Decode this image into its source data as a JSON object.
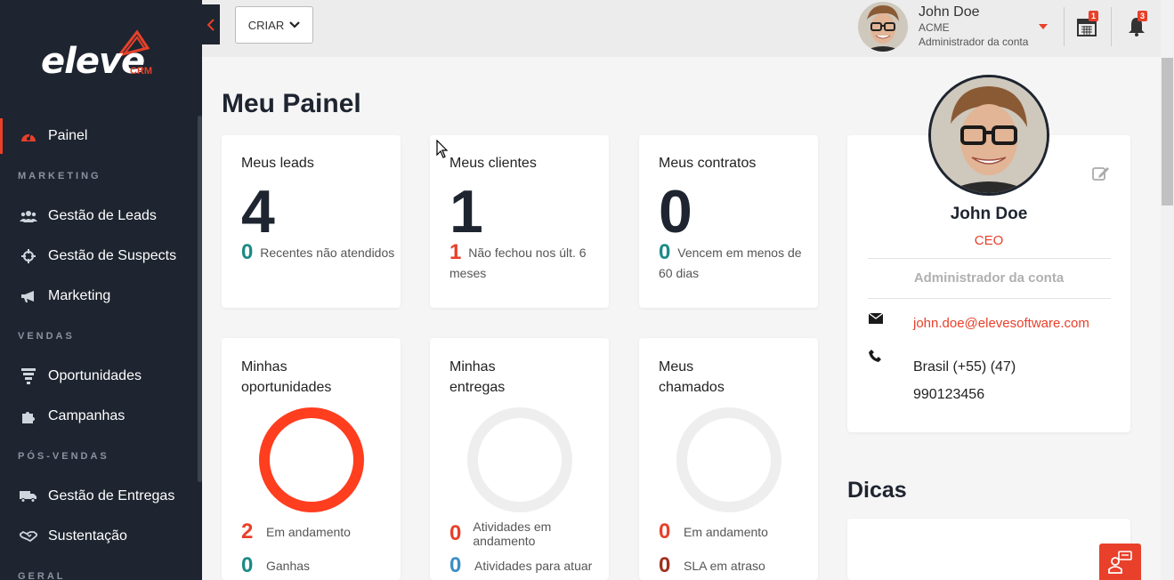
{
  "brand": {
    "name": "eleve",
    "sub": "CRM",
    "accent": "#e8402a"
  },
  "sidebar": {
    "items": [
      {
        "label": "Painel",
        "icon": "dashboard-icon"
      },
      {
        "label": "Gestão de Leads",
        "icon": "users-icon"
      },
      {
        "label": "Gestão de Suspects",
        "icon": "crosshair-icon"
      },
      {
        "label": "Marketing",
        "icon": "megaphone-icon"
      },
      {
        "label": "Oportunidades",
        "icon": "funnel-icon"
      },
      {
        "label": "Campanhas",
        "icon": "puzzle-icon"
      },
      {
        "label": "Gestão de Entregas",
        "icon": "truck-icon"
      },
      {
        "label": "Sustentação",
        "icon": "handshake-icon"
      }
    ],
    "sections": {
      "marketing": "MARKETING",
      "vendas": "VENDAS",
      "pos_vendas": "PÓS-VENDAS",
      "geral": "GERAL"
    }
  },
  "header": {
    "criar_label": "CRIAR",
    "user": {
      "name": "John Doe",
      "company": "ACME",
      "role": "Administrador da conta"
    },
    "calendar_badge": "1",
    "notifications_badge": "3"
  },
  "main": {
    "title": "Meu Painel",
    "cards": {
      "leads": {
        "title": "Meus leads",
        "value": "4",
        "sub_num": "0",
        "sub_text": "Recentes não atendidos"
      },
      "clientes": {
        "title": "Meus clientes",
        "value": "1",
        "sub_num": "1",
        "sub_text": "Não fechou nos últ. 6 meses"
      },
      "contratos": {
        "title": "Meus contratos",
        "value": "0",
        "sub_num": "0",
        "sub_text": "Vencem em menos de 60 dias"
      }
    },
    "oportunidades": {
      "title_1": "Minhas",
      "title_2": "oportunidades",
      "stat1_num": "2",
      "stat1_label": "Em andamento",
      "stat2_num": "0",
      "stat2_label": "Ganhas"
    },
    "entregas": {
      "title_1": "Minhas",
      "title_2": "entregas",
      "stat1_num": "0",
      "stat1_label": "Atividades em andamento",
      "stat2_num": "0",
      "stat2_label": "Atividades para atuar"
    },
    "chamados": {
      "title_1": "Meus",
      "title_2": "chamados",
      "stat1_num": "0",
      "stat1_label": "Em andamento",
      "stat2_num": "0",
      "stat2_label": "SLA em atraso"
    }
  },
  "profile": {
    "name": "John Doe",
    "title": "CEO",
    "role": "Administrador da conta",
    "email": "john.doe@elevesoftware.com",
    "phone_line1": "Brasil (+55) (47)",
    "phone_line2": "990123456"
  },
  "dicas": {
    "title": "Dicas"
  }
}
